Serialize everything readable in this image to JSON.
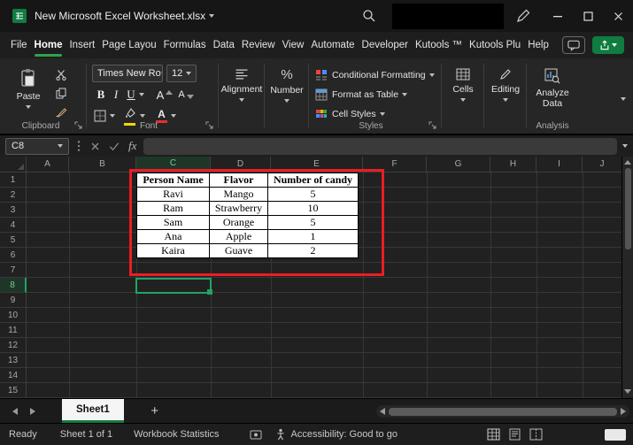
{
  "window": {
    "title": "New Microsoft Excel Worksheet.xlsx"
  },
  "menu": {
    "active_tab": "Home",
    "tabs": [
      "File",
      "Home",
      "Insert",
      "Page Layou",
      "Formulas",
      "Data",
      "Review",
      "View",
      "Automate",
      "Developer",
      "Kutools ™",
      "Kutools Plu",
      "Help"
    ]
  },
  "ribbon": {
    "clipboard": {
      "group_label": "Clipboard",
      "paste_label": "Paste"
    },
    "font": {
      "group_label": "Font",
      "font_name": "Times New Ro",
      "font_size": "12",
      "bold": "B",
      "italic": "I",
      "underline": "U",
      "letter": "A"
    },
    "alignment": {
      "label": "Alignment"
    },
    "number": {
      "label": "Number",
      "symbol": "%"
    },
    "styles": {
      "group_label": "Styles",
      "conditional_formatting": "Conditional Formatting",
      "format_as_table": "Format as Table",
      "cell_styles": "Cell Styles"
    },
    "cells": {
      "label": "Cells"
    },
    "editing": {
      "label": "Editing"
    },
    "analysis": {
      "group_label": "Analysis",
      "analyze_data": "Analyze Data"
    }
  },
  "formula_bar": {
    "name_box": "C8",
    "fx": "fx",
    "formula": ""
  },
  "grid": {
    "selected_cell": "C8",
    "columns": [
      "A",
      "B",
      "C",
      "D",
      "E",
      "F",
      "G",
      "H",
      "I",
      "J"
    ],
    "rows": [
      "1",
      "2",
      "3",
      "4",
      "5",
      "6",
      "7",
      "8",
      "9",
      "10",
      "11",
      "12",
      "13",
      "14",
      "15"
    ]
  },
  "table": {
    "headers": [
      "Person Name",
      "Flavor",
      "Number of candy"
    ],
    "rows": [
      [
        "Ravi",
        "Mango",
        "5"
      ],
      [
        "Ram",
        "Strawberry",
        "10"
      ],
      [
        "Sam",
        "Orange",
        "5"
      ],
      [
        "Ana",
        "Apple",
        "1"
      ],
      [
        "Kaira",
        "Guave",
        "2"
      ]
    ]
  },
  "sheet_bar": {
    "tab": "Sheet1",
    "add": "+"
  },
  "status_bar": {
    "ready": "Ready",
    "sheet_info": "Sheet 1 of 1",
    "workbook_statistics": "Workbook Statistics",
    "accessibility": "Accessibility: Good to go"
  },
  "colors": {
    "excel_green": "#107C41",
    "active_tab_underline": "#2EA34D",
    "selection_green": "#21A366",
    "annotation_red": "#EC1C24",
    "table_bg": "#FFFFFF",
    "table_text": "#000000"
  }
}
